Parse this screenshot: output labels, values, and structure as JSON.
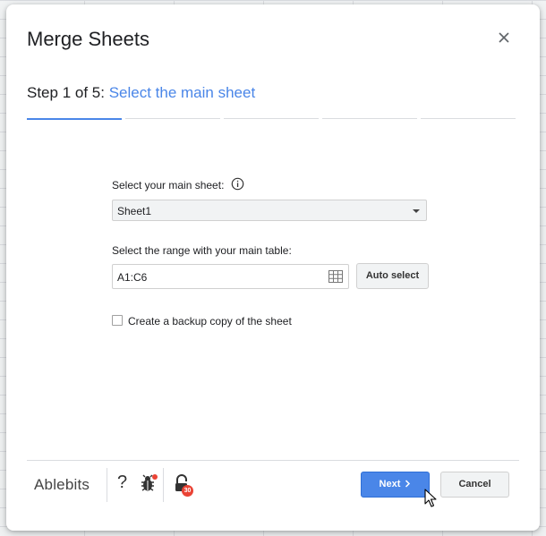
{
  "dialog": {
    "title": "Merge Sheets",
    "step_prefix": "Step 1 of 5:",
    "step_title": "Select the main sheet"
  },
  "form": {
    "main_sheet_label": "Select your main sheet:",
    "main_sheet_value": "Sheet1",
    "range_label": "Select the range with your main table:",
    "range_value": "A1:C6",
    "auto_select_label": "Auto select",
    "backup_label": "Create a backup copy of the sheet",
    "backup_checked": false
  },
  "footer": {
    "brand": "Ablebits",
    "help_label": "?",
    "notification_count": "30",
    "next_label": "Next",
    "cancel_label": "Cancel"
  },
  "progress": {
    "current_step": 1,
    "total_steps": 5
  },
  "colors": {
    "accent": "#4a86e8",
    "badge": "#ea4335",
    "primary_button": "#4a86e8"
  },
  "icons": [
    "close-icon",
    "info-icon",
    "dropdown-arrow-icon",
    "grid-select-icon",
    "bug-icon",
    "lock-icon",
    "chevron-right-icon",
    "mouse-cursor-icon"
  ]
}
